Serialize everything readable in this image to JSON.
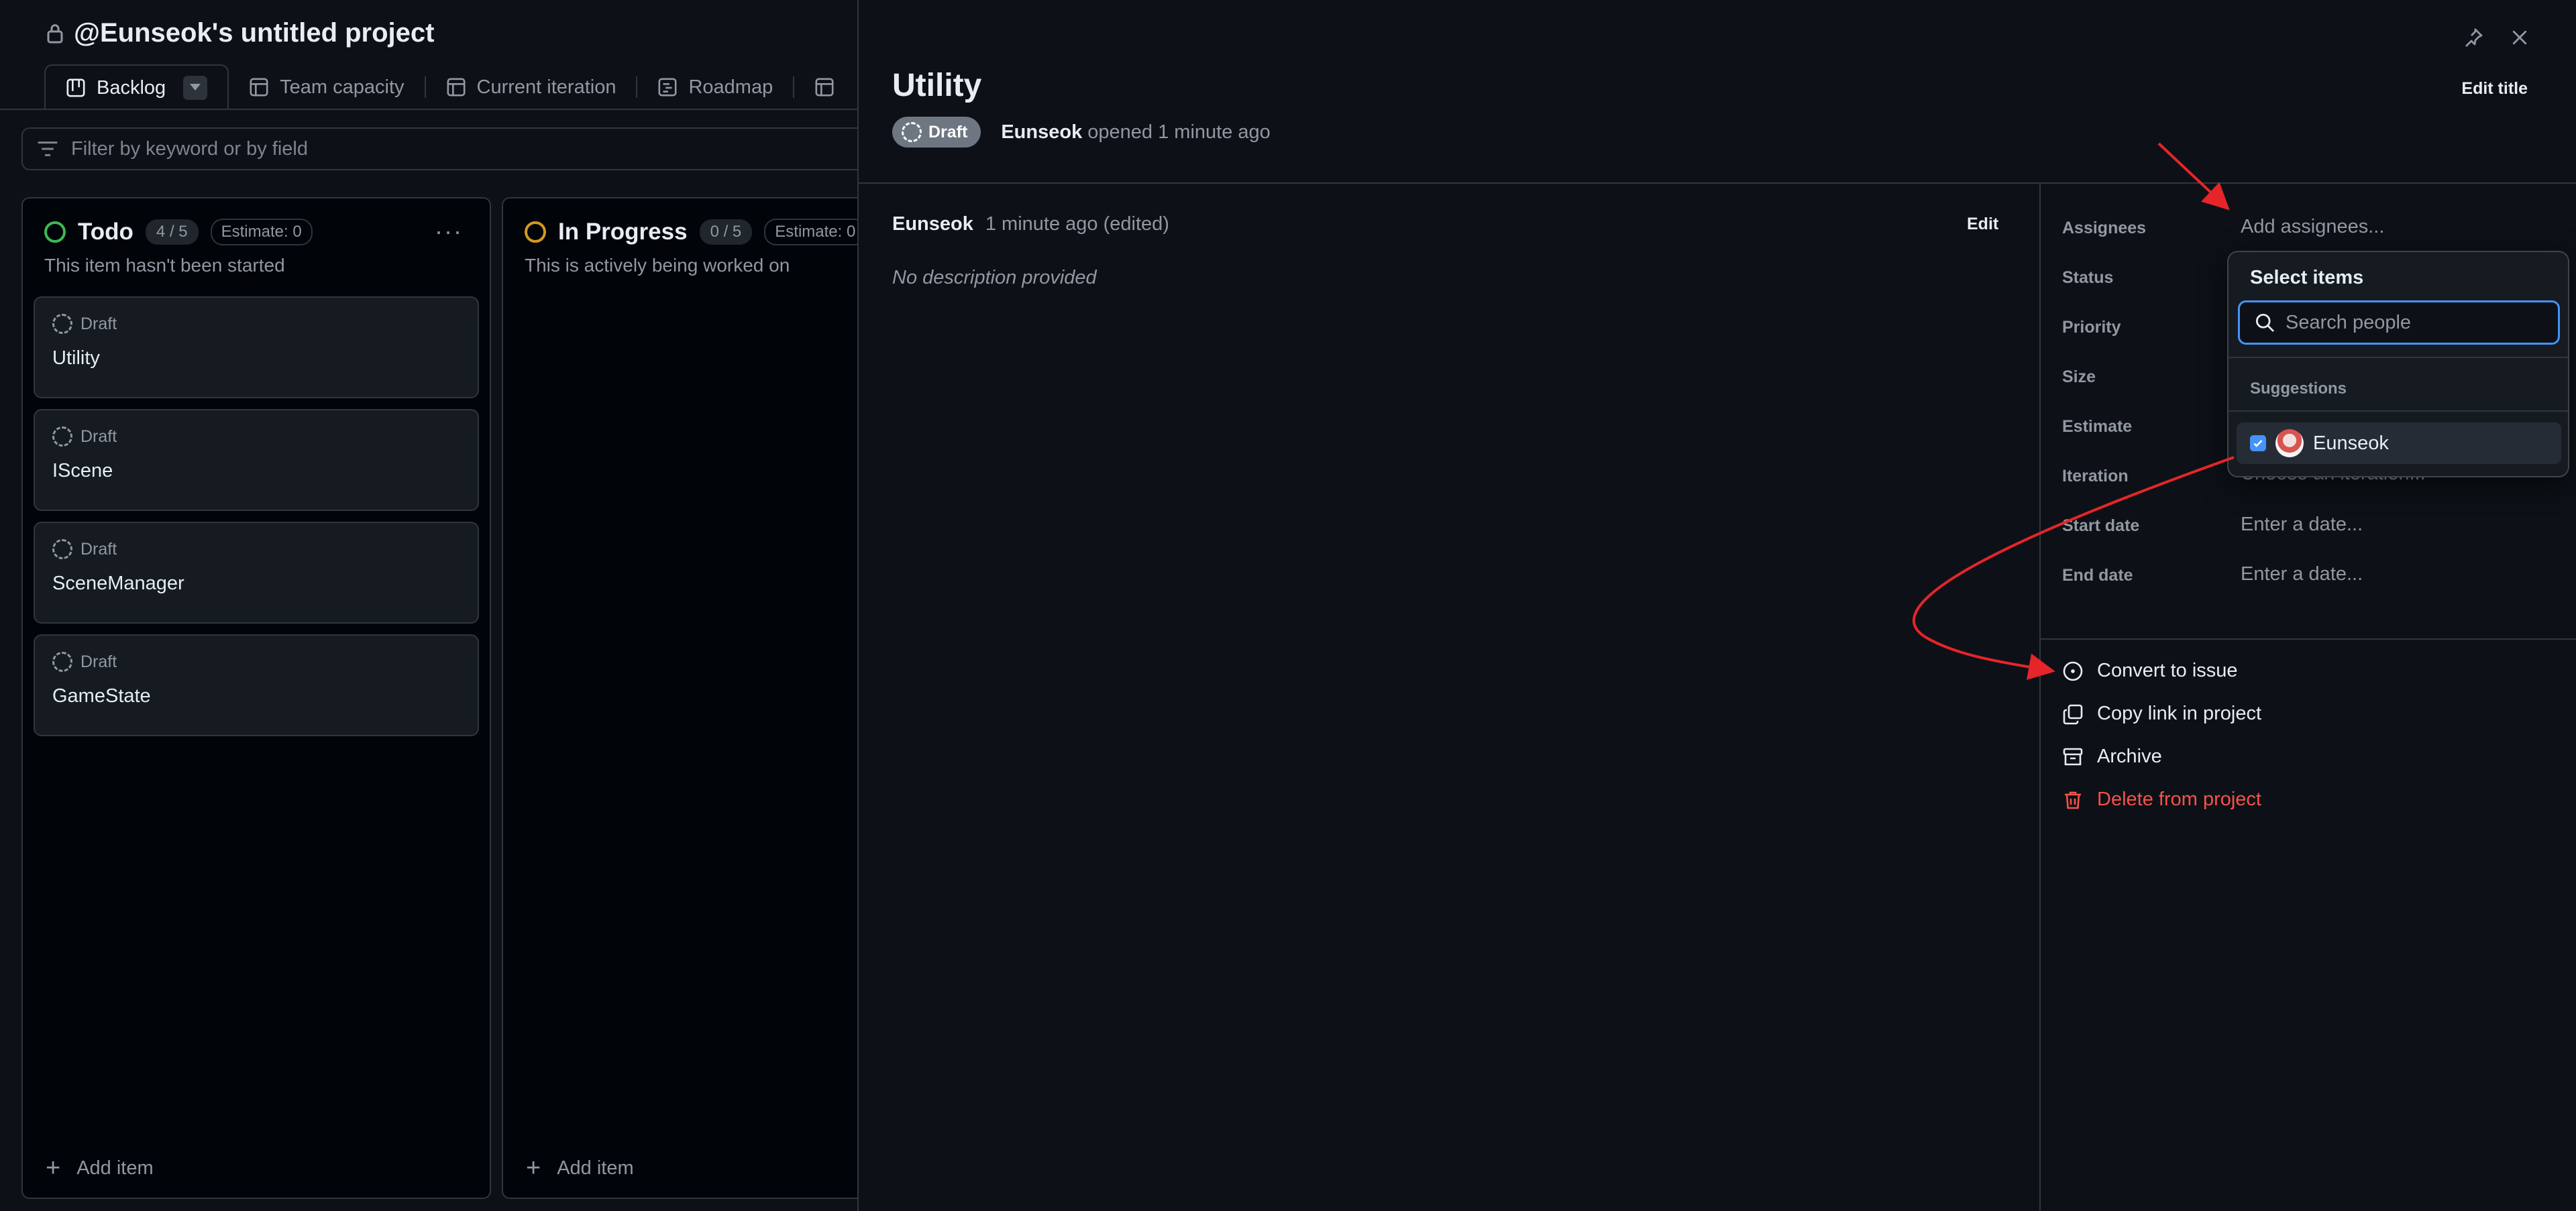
{
  "project": {
    "title": "@Eunseok's untitled project"
  },
  "tabs": [
    {
      "label": "Backlog",
      "icon": "board-icon",
      "active": true
    },
    {
      "label": "Team capacity",
      "icon": "table-icon"
    },
    {
      "label": "Current iteration",
      "icon": "table-icon"
    },
    {
      "label": "Roadmap",
      "icon": "roadmap-icon"
    }
  ],
  "filter": {
    "placeholder": "Filter by keyword or by field"
  },
  "columns": [
    {
      "name": "Todo",
      "count": "4 / 5",
      "estimate": "Estimate: 0",
      "description": "This item hasn't been started",
      "status_color": "#3fb950",
      "cards": [
        {
          "status": "Draft",
          "title": "Utility"
        },
        {
          "status": "Draft",
          "title": "IScene"
        },
        {
          "status": "Draft",
          "title": "SceneManager"
        },
        {
          "status": "Draft",
          "title": "GameState"
        }
      ],
      "add_label": "Add item"
    },
    {
      "name": "In Progress",
      "count": "0 / 5",
      "estimate": "Estimate: 0",
      "description": "This is actively being worked on",
      "status_color": "#d29922",
      "cards": [],
      "add_label": "Add item"
    }
  ],
  "panel": {
    "title": "Utility",
    "edit_title_label": "Edit title",
    "status_pill": "Draft",
    "author": "Eunseok",
    "opened_text": "opened 1 minute ago",
    "comment": {
      "author": "Eunseok",
      "time": "1 minute ago (edited)",
      "edit_label": "Edit",
      "body": "No description provided"
    },
    "fields": [
      {
        "label": "Assignees",
        "value": "Add assignees..."
      },
      {
        "label": "Status",
        "value": ""
      },
      {
        "label": "Priority",
        "value": ""
      },
      {
        "label": "Size",
        "value": ""
      },
      {
        "label": "Estimate",
        "value": ""
      },
      {
        "label": "Iteration",
        "value": "Choose an iteration..."
      },
      {
        "label": "Start date",
        "value": "Enter a date..."
      },
      {
        "label": "End date",
        "value": "Enter a date..."
      }
    ],
    "actions": [
      {
        "label": "Convert to issue",
        "icon": "issue-circle-icon"
      },
      {
        "label": "Copy link in project",
        "icon": "copy-icon"
      },
      {
        "label": "Archive",
        "icon": "archive-icon"
      },
      {
        "label": "Delete from project",
        "icon": "trash-icon",
        "danger": true
      }
    ]
  },
  "dropdown": {
    "title": "Select items",
    "search_placeholder": "Search people",
    "suggestions_label": "Suggestions",
    "items": [
      {
        "name": "Eunseok",
        "checked": true
      }
    ]
  },
  "colors": {
    "background": "#0d1117",
    "border": "#30363d",
    "accent": "#4493f8",
    "danger": "#f85149",
    "annotation": "#e5252a"
  }
}
